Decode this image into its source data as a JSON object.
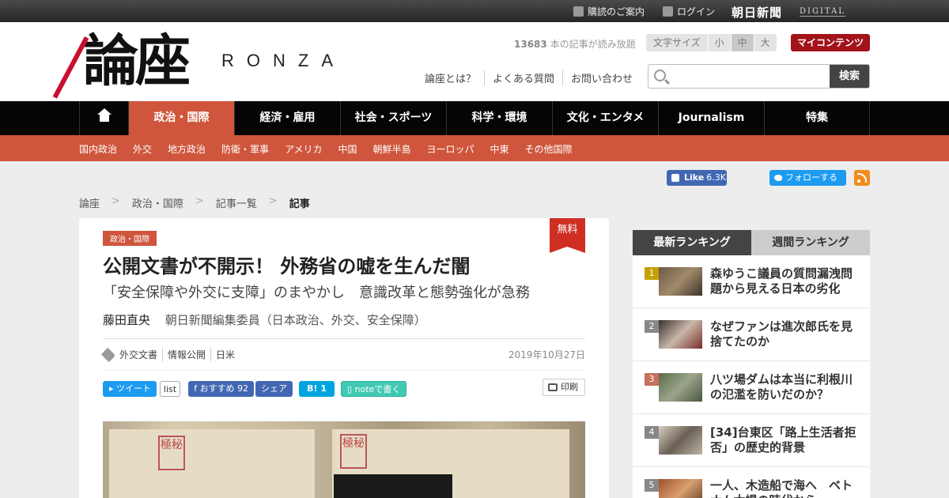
{
  "topbar": {
    "subscribe_label": "購読のご案内",
    "login_label": "ログイン",
    "asahi_label": "朝日新聞",
    "digital_label": "DIGITAL"
  },
  "header": {
    "logo_kanji": "論座",
    "logo_roman": "RONZA",
    "read_count": "13683",
    "read_count_suffix": " 本の記事が読み放題",
    "font_size": {
      "label": "文字サイズ",
      "options": [
        "小",
        "中",
        "大"
      ],
      "selected": "中"
    },
    "my_contents_label": "マイコンテンツ",
    "links": [
      "論座とは？",
      "よくある質問",
      "お問い合わせ"
    ],
    "search": {
      "placeholder": "",
      "button_label": "検索"
    }
  },
  "nav": {
    "home_icon": "home-icon",
    "items": [
      "政治・国際",
      "経済・雇用",
      "社会・スポーツ",
      "科学・環境",
      "文化・エンタメ",
      "Journalism",
      "特集"
    ],
    "active": "政治・国際"
  },
  "subcategories": [
    "国内政治",
    "外交",
    "地方政治",
    "防衛・軍事",
    "アメリカ",
    "中国",
    "朝鮮半島",
    "ヨーロッパ",
    "中東",
    "その他国際"
  ],
  "social": {
    "fb_like_label": "Like",
    "fb_like_count": "6.3K",
    "twitter_follow_label": "フォローする",
    "rss_icon": "rss-icon"
  },
  "breadcrumb": [
    "論座",
    "政治・国際",
    "記事一覧",
    "記事"
  ],
  "article": {
    "category_badge": "政治・国際",
    "free_badge": "無料",
    "title": "公開文書が不開示！ 外務省の嘘を生んだ闇",
    "subtitle": "「安全保障や外交に支障」のまやかし　意識改革と態勢強化が急務",
    "author_name": "藤田直央",
    "author_role": "朝日新聞編集委員（日本政治、外交、安全保障）",
    "tags": [
      "外交文書",
      "情報公開",
      "日米"
    ],
    "date": "2019年10月27日",
    "share": {
      "tweet_label": "ツイート",
      "list_label": "list",
      "fb_label": "おすすめ",
      "fb_count": "92",
      "fb_share_label": "シェア",
      "hatena_label": "B!",
      "hatena_count": "1",
      "note_label": "noteで書く",
      "print_label": "印刷"
    },
    "hero_stamp_text": "極秘"
  },
  "ranking": {
    "tabs": [
      "最新ランキング",
      "週間ランキング"
    ],
    "active_tab": "最新ランキング",
    "items": [
      {
        "rank": "1",
        "title": "森ゆうこ議員の質問漏洩問題から見える日本の劣化"
      },
      {
        "rank": "2",
        "title": "なぜファンは進次郎氏を見捨てたのか"
      },
      {
        "rank": "3",
        "title": "八ツ場ダムは本当に利根川の氾濫を防いだのか？"
      },
      {
        "rank": "4",
        "title": "[34]台東区「路上生活者拒否」の歴史的背景"
      },
      {
        "rank": "5",
        "title": "一人、木造船で海へ　ベトナム木場の時代から"
      }
    ]
  },
  "colors": {
    "accent": "#cf563c",
    "nav_bg": "#050505",
    "rank_badges": [
      "#c5a000",
      "#888888",
      "#c6705f",
      "#888888",
      "#888888"
    ]
  }
}
